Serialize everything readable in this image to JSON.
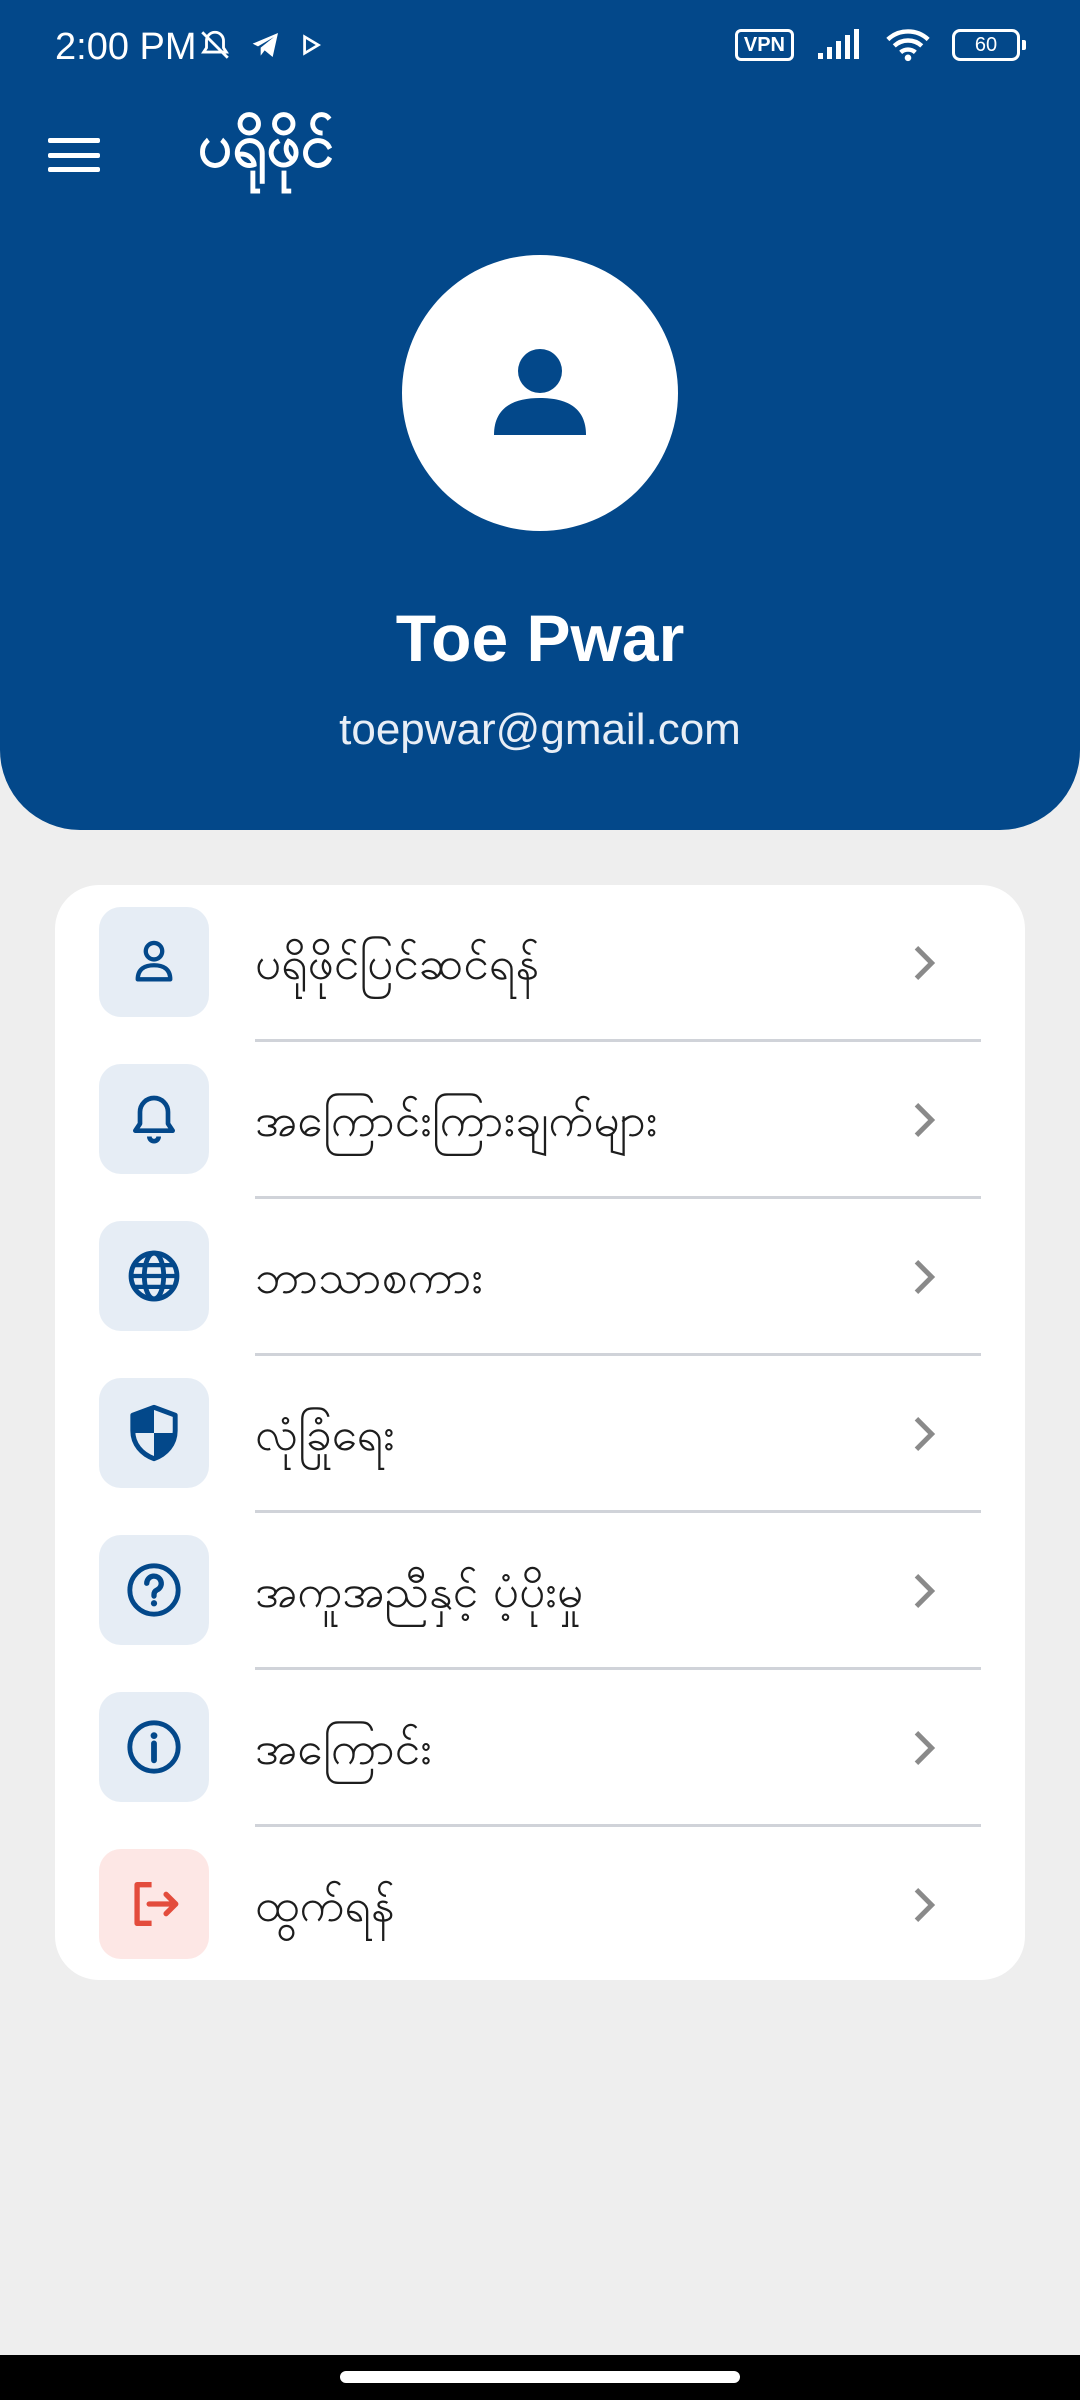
{
  "status_bar": {
    "time": "2:00 PM",
    "vpn": "VPN",
    "battery": "60"
  },
  "app_bar": {
    "title": "ပရိုဖိုင်",
    "menu_icon": "hamburger-menu-icon"
  },
  "profile": {
    "avatar_icon": "person-icon",
    "name": "Toe Pwar",
    "email": "toepwar@gmail.com"
  },
  "menu": {
    "items": [
      {
        "label": "ပရိုဖိုင်ပြင်ဆင်ရန်",
        "icon": "user-outline-icon"
      },
      {
        "label": "အကြောင်းကြားချက်များ",
        "icon": "bell-icon"
      },
      {
        "label": "ဘာသာစကား",
        "icon": "globe-icon"
      },
      {
        "label": "လုံခြုံရေး",
        "icon": "shield-icon"
      },
      {
        "label": "အကူအညီနှင့် ပံ့ပိုးမှု",
        "icon": "help-circle-icon"
      },
      {
        "label": "အကြောင်း",
        "icon": "info-circle-icon"
      },
      {
        "label": "ထွက်ရန်",
        "icon": "logout-icon"
      }
    ]
  },
  "colors": {
    "primary": "#03488a",
    "icon_bg": "#e6edf5",
    "danger": "#e34c3c",
    "danger_bg": "#fde7e5",
    "background": "#eeeeee"
  }
}
